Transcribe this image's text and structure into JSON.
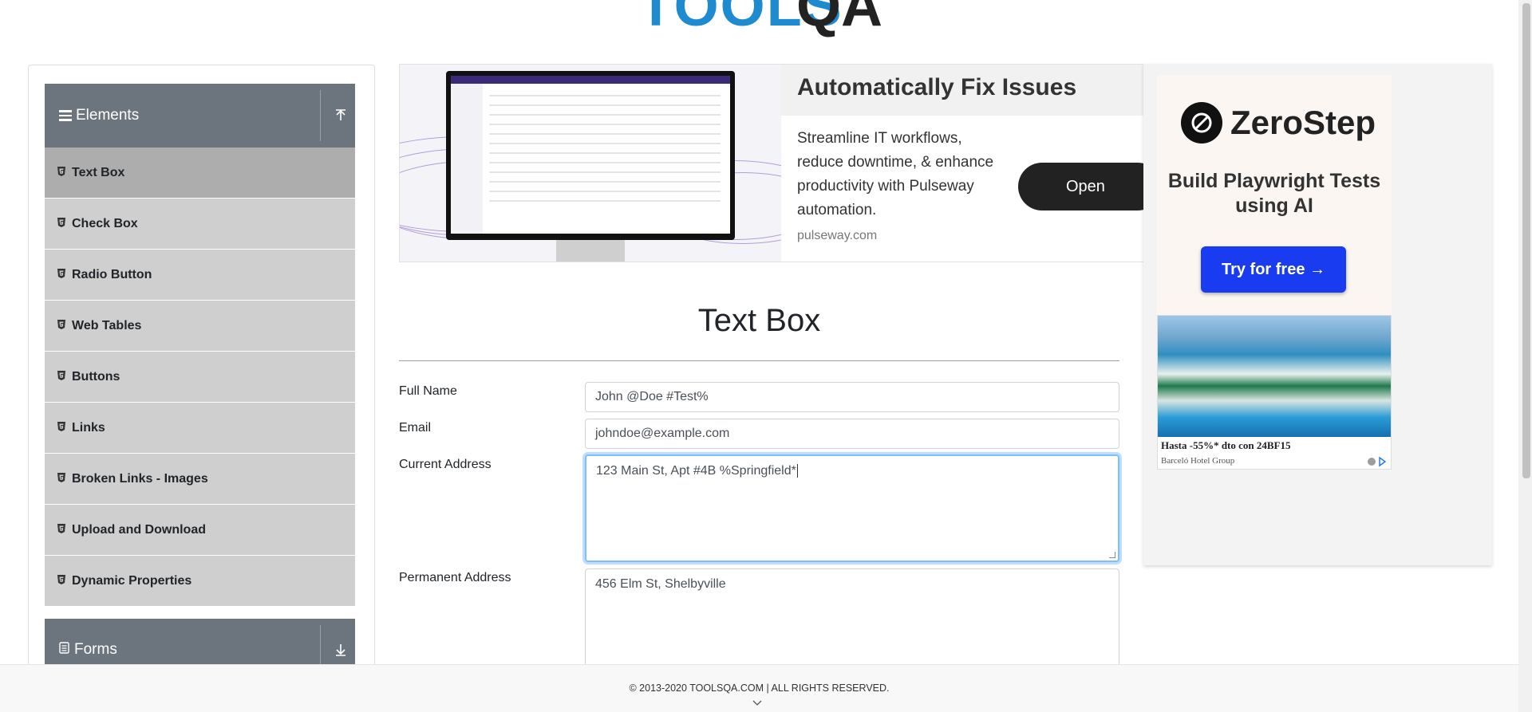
{
  "header": {
    "logo_text": "TOOLS",
    "logo_qa": "QA"
  },
  "sidebar": {
    "group_elements": {
      "label": "Elements",
      "toggle_icon": "upload-arrow-icon"
    },
    "items": [
      {
        "label": "Text Box",
        "active": true
      },
      {
        "label": "Check Box"
      },
      {
        "label": "Radio Button"
      },
      {
        "label": "Web Tables"
      },
      {
        "label": "Buttons"
      },
      {
        "label": "Links"
      },
      {
        "label": "Broken Links - Images"
      },
      {
        "label": "Upload and Download"
      },
      {
        "label": "Dynamic Properties"
      }
    ],
    "group_forms": {
      "label": "Forms",
      "toggle_icon": "download-arrow-icon"
    }
  },
  "ad_banner": {
    "title": "Automatically Fix Issues",
    "description": "Streamline IT workflows, reduce downtime, & enhance productivity with Pulseway automation.",
    "url": "pulseway.com",
    "button": "Open"
  },
  "page": {
    "title": "Text Box"
  },
  "form": {
    "full_name": {
      "label": "Full Name",
      "value": "John @Doe #Test%"
    },
    "email": {
      "label": "Email",
      "value": "johndoe@example.com"
    },
    "current_address": {
      "label": "Current Address",
      "value": "123 Main St, Apt #4B %Springfield*"
    },
    "permanent_address": {
      "label": "Permanent Address",
      "value": "456 Elm St, Shelbyville"
    }
  },
  "side_ad": {
    "brand": "ZeroStep",
    "headline": "Build Playwright Tests using AI",
    "button": "Try for free →",
    "hotel_title": "Hasta -55%* dto con 24BF15",
    "hotel_sub": "Barceló Hotel Group"
  },
  "footer": {
    "text": "© 2013-2020 TOOLSQA.COM | ALL RIGHTS RESERVED."
  },
  "colors": {
    "accent_blue": "#1e8ad0",
    "sidebar_header": "#6c757d",
    "menu_item": "#cfcfcf",
    "menu_active": "#adadad",
    "zs_button": "#1a3cf0"
  }
}
